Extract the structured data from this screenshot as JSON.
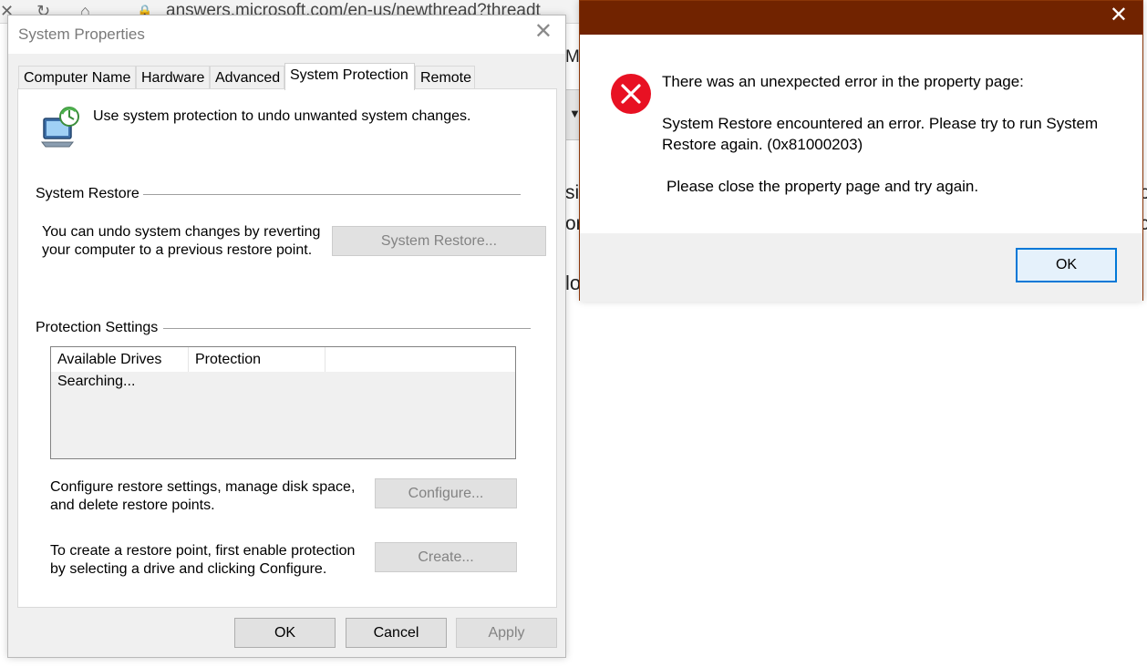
{
  "browser": {
    "url": "answers.microsoft.com/en-us/newthread?threadt",
    "fragments": [
      "My",
      "sic",
      "or",
      "lo",
      "o",
      "c"
    ]
  },
  "system_properties": {
    "title": "System Properties",
    "tabs": [
      "Computer Name",
      "Hardware",
      "Advanced",
      "System Protection",
      "Remote"
    ],
    "active_tab": "System Protection",
    "intro": "Use system protection to undo unwanted system changes.",
    "system_restore": {
      "heading": "System Restore",
      "desc_line1": "You can undo system changes by reverting",
      "desc_line2": "your computer to a previous restore point.",
      "button": "System Restore..."
    },
    "protection_settings": {
      "heading": "Protection Settings",
      "columns": [
        "Available Drives",
        "Protection"
      ],
      "status_row": "Searching...",
      "configure_line1": "Configure restore settings, manage disk space,",
      "configure_line2": "and delete restore points.",
      "configure_button": "Configure...",
      "create_line1": "To create a restore point, first enable protection",
      "create_line2": "by selecting a drive and clicking Configure.",
      "create_button": "Create..."
    },
    "buttons": {
      "ok": "OK",
      "cancel": "Cancel",
      "apply": "Apply"
    }
  },
  "error_dialog": {
    "line1": "There was an unexpected error in the property page:",
    "line2": "System Restore encountered an error. Please try to run System",
    "line3": "Restore again. (0x81000203)",
    "line4": "Please close the property page and try again.",
    "ok": "OK",
    "titlebar_color": "#712300"
  }
}
